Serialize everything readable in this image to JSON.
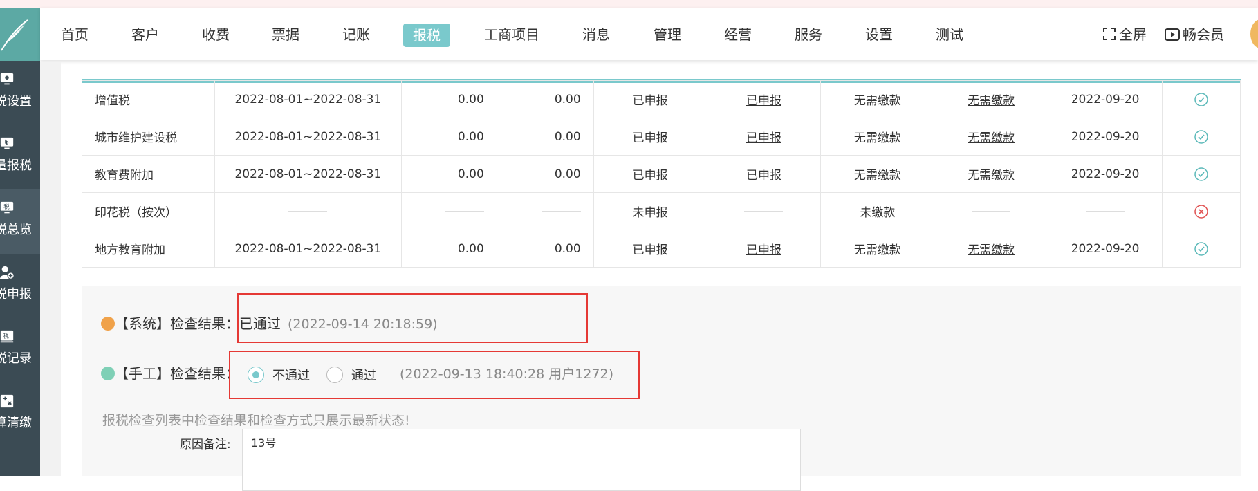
{
  "topnav": {
    "items": [
      "首页",
      "客户",
      "收费",
      "票据",
      "记账",
      "报税",
      "工商项目",
      "消息",
      "管理",
      "经营",
      "服务",
      "设置",
      "测试"
    ],
    "active": "报税",
    "fullscreen_label": "全屏",
    "member_label": "畅会员"
  },
  "sidebar": {
    "items": [
      {
        "label": "税设置",
        "icon": "gear-monitor-icon"
      },
      {
        "label": "量报税",
        "icon": "cursor-monitor-icon"
      },
      {
        "label": "税总览",
        "icon": "tax-monitor-icon"
      },
      {
        "label": "税申报",
        "icon": "user-add-icon"
      },
      {
        "label": "税记录",
        "icon": "tax-record-icon"
      },
      {
        "label": "算清缴",
        "icon": "calculator-icon"
      }
    ],
    "active": "税总览"
  },
  "table": {
    "rows": [
      {
        "name": "增值税",
        "period": "2022-08-01~2022-08-31",
        "amt1": "0.00",
        "amt2": "0.00",
        "declare": "已申报",
        "declare_link": "已申报",
        "pay": "无需缴款",
        "pay_link": "无需缴款",
        "date": "2022-09-20",
        "status": "ok"
      },
      {
        "name": "城市维护建设税",
        "period": "2022-08-01~2022-08-31",
        "amt1": "0.00",
        "amt2": "0.00",
        "declare": "已申报",
        "declare_link": "已申报",
        "pay": "无需缴款",
        "pay_link": "无需缴款",
        "date": "2022-09-20",
        "status": "ok"
      },
      {
        "name": "教育费附加",
        "period": "2022-08-01~2022-08-31",
        "amt1": "0.00",
        "amt2": "0.00",
        "declare": "已申报",
        "declare_link": "已申报",
        "pay": "无需缴款",
        "pay_link": "无需缴款",
        "date": "2022-09-20",
        "status": "ok"
      },
      {
        "name": "印花税（按次）",
        "period": "",
        "amt1": "",
        "amt2": "",
        "declare": "未申报",
        "declare_link": "",
        "pay": "未缴款",
        "pay_link": "",
        "date": "",
        "status": "fail"
      },
      {
        "name": "地方教育附加",
        "period": "2022-08-01~2022-08-31",
        "amt1": "0.00",
        "amt2": "0.00",
        "declare": "已申报",
        "declare_link": "已申报",
        "pay": "无需缴款",
        "pay_link": "无需缴款",
        "date": "2022-09-20",
        "status": "ok"
      }
    ]
  },
  "check": {
    "system_label": "【系统】检查结果：",
    "system_result": "已通过",
    "system_time": "(2022-09-14 20:18:59)",
    "manual_label": "【手工】检查结果：",
    "option_fail": "不通过",
    "option_pass": "通过",
    "selected": "不通过",
    "manual_time": "(2022-09-13 18:40:28 用户1272)",
    "notice": "报税检查列表中检查结果和检查方式只展示最新状态!",
    "remark_label": "原因备注:",
    "remark_value": "13号"
  },
  "colors": {
    "accent": "#7ac9cc",
    "sidebar_bg": "#3b4b54",
    "ok": "#5bb9b9",
    "fail": "#e05050",
    "highlight": "#e53935"
  }
}
